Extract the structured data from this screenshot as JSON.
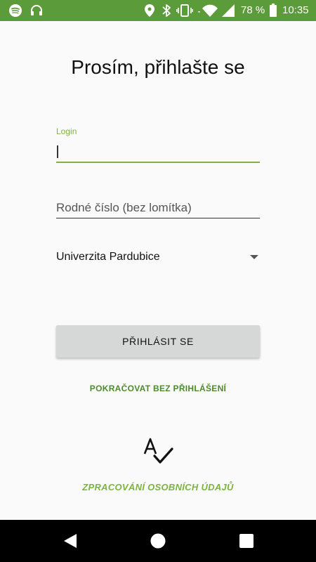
{
  "status_bar": {
    "battery_percent": "78 %",
    "time": "10:35",
    "icons": [
      "spotify-icon",
      "headset-icon",
      "location-icon",
      "bluetooth-icon",
      "vibrate-icon",
      "wifi-icon",
      "signal-icon",
      "battery-icon"
    ],
    "color": "#5c9b3a"
  },
  "title": "Prosím, přihlašte se",
  "login_field": {
    "label": "Login",
    "value": "",
    "accent_color": "#7cb342"
  },
  "rc_field": {
    "placeholder": "Rodné číslo (bez lomítka)",
    "value": ""
  },
  "university_select": {
    "selected": "Univerzita Pardubice"
  },
  "login_button": {
    "label": "PŘIHLÁSIT SE"
  },
  "continue_link": {
    "label": "POKRAČOVAT BEZ PŘIHLÁŠENÍ"
  },
  "privacy_link": {
    "label": "ZPRACOVÁNÍ OSOBNÍCH ÚDAJŮ",
    "icon": "spellcheck-icon"
  },
  "nav_bar": {
    "icons": [
      "back-icon",
      "home-icon",
      "recents-icon"
    ]
  }
}
